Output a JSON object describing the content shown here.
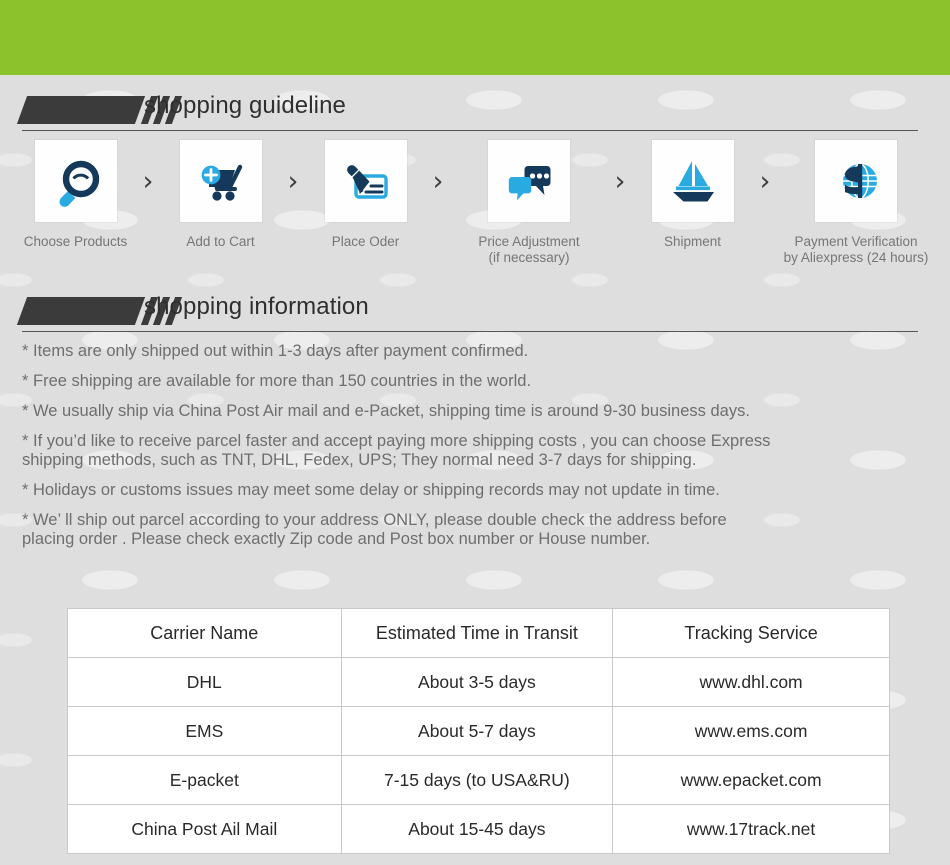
{
  "theme": {
    "green": "#8cc22b",
    "page_bg": "#dedede",
    "banner_dark": "#3b3b3b",
    "icon_navy": "#15395b",
    "icon_cyan": "#29abe2",
    "text_gray": "#6e6e6e",
    "table_border": "#c9c9c9"
  },
  "guideline": {
    "heading": "shopping guideline",
    "separator_icon": "chevron-right-icon",
    "steps": [
      {
        "icon": "magnifier-icon",
        "label": "Choose Products"
      },
      {
        "icon": "add-to-cart-icon",
        "label": "Add to Cart"
      },
      {
        "icon": "pen-card-icon",
        "label": "Place Oder"
      },
      {
        "icon": "chat-bubbles-icon",
        "label": "Price Adjustment\n(if necessary)"
      },
      {
        "icon": "sailboat-icon",
        "label": "Shipment"
      },
      {
        "icon": "dollar-globe-icon",
        "label": "Payment Verification\nby  Aliexpress (24 hours)"
      }
    ]
  },
  "information": {
    "heading": "shopping information",
    "bullets": [
      "* Items are only shipped out within 1-3 days after payment confirmed.",
      "* Free shipping are available for more than 150 countries in the world.",
      "* We usually ship via China Post Air mail and e-Packet, shipping time is around 9-30 business days.",
      "* If you’d like to receive parcel faster and accept paying more shipping costs , you can choose Express\n   shipping methods, such as TNT, DHL, Fedex, UPS; They normal need 3-7 days for shipping.",
      "* Holidays or customs issues may meet some delay or shipping records may not update in time.",
      "* We’ ll ship out parcel according to your address ONLY, please double check the address before\n   placing order . Please check exactly Zip code and Post box number or House number."
    ]
  },
  "carrier_table": {
    "headers": [
      "Carrier Name",
      "Estimated Time in Transit",
      "Tracking Service"
    ],
    "rows": [
      [
        "DHL",
        "About 3-5 days",
        "www.dhl.com"
      ],
      [
        "EMS",
        "About 5-7 days",
        "www.ems.com"
      ],
      [
        "E-packet",
        "7-15 days (to USA&RU)",
        "www.epacket.com"
      ],
      [
        "China Post Ail Mail",
        "About 15-45 days",
        "www.17track.net"
      ]
    ]
  }
}
